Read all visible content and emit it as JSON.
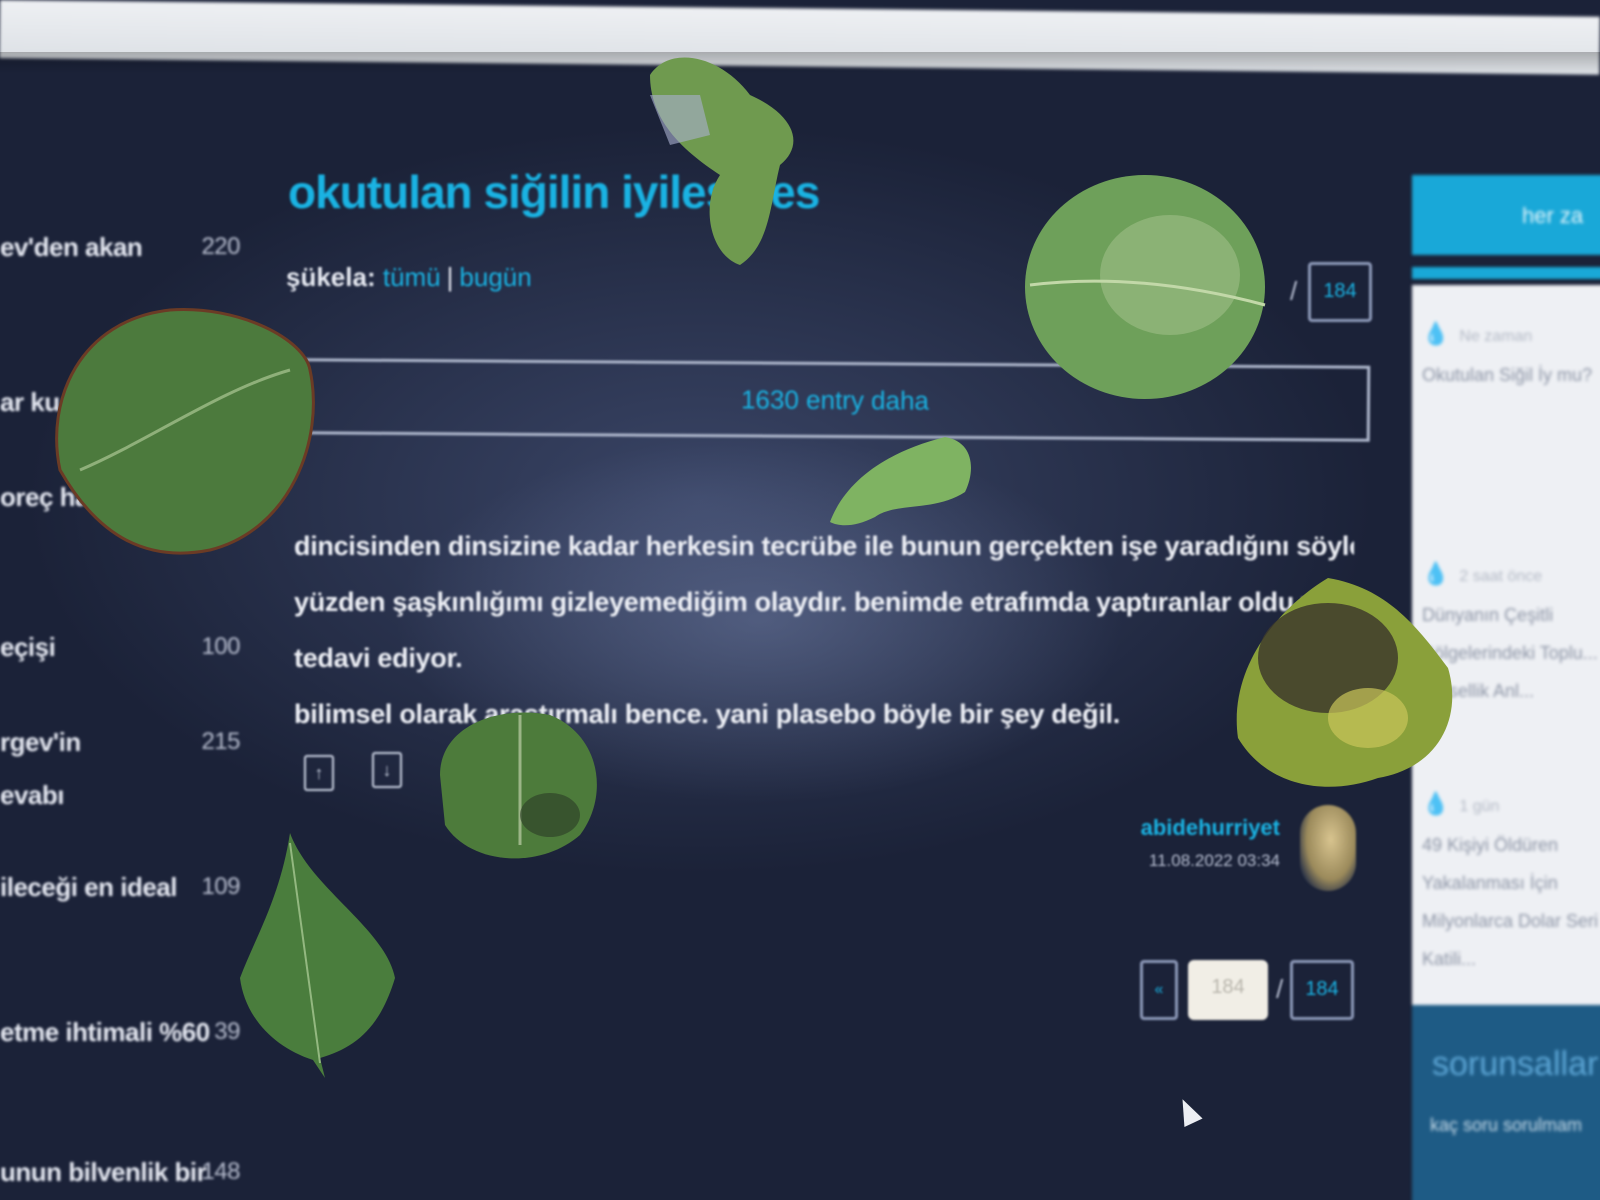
{
  "topbar": {
    "nav_items": [
      "",
      "",
      "",
      "",
      ""
    ]
  },
  "sidebar": {
    "topics": [
      {
        "label": "ev'den akan",
        "count": "220"
      },
      {
        "label": "ar ku",
        "count": ""
      },
      {
        "label": "oreç hazırlan",
        "count": ""
      },
      {
        "label": "eçişi",
        "count": "100"
      },
      {
        "label": "rgev'in",
        "count": "215"
      },
      {
        "label": "evabı",
        "count": ""
      },
      {
        "label": "ileceği en ideal",
        "count": "109"
      },
      {
        "label": "etme ihtimali %60",
        "count": "39"
      },
      {
        "label": "unun bilvenlik bir",
        "count": "148"
      }
    ]
  },
  "main": {
    "title": "okutulan siğilin iyileşmes",
    "sukela_label": "şükela:",
    "sukela_all": "tümü",
    "sukela_sep": "|",
    "sukela_today": "bugün",
    "page_total": "184",
    "more_entries": "1630 entry daha",
    "entry_lines": [
      "dincisinden dinsizine kadar herkesin tecrübe ile bunun gerçekten işe yaradığını söylediği ve bu",
      "yüzden şaşkınlığımı gizleyemediğim olaydır. benimde etrafımda yaptıranlar oldu ve sonuç !",
      "tedavi ediyor.",
      "bilimsel olarak araştırmalı bence. yani plasebo böyle bir şey değil."
    ],
    "vote_up": "↑",
    "vote_down": "↓",
    "author_name": "abidehurriyet",
    "entry_date": "11.08.2022 03:34",
    "page_current": "184",
    "slash": "/",
    "prev_label": "«"
  },
  "right_panel": {
    "tab_label": "her za",
    "cards": [
      {
        "meta": "Ne zaman",
        "text": "Okutulan Siğil İy mu?"
      },
      {
        "meta": "2 saat önce",
        "text": "Dünyanın Çeşitli Bölgelerindeki Toplu... Cinsellik Anl..."
      },
      {
        "meta": "1 gün",
        "text": "49 Kişiyi Öldüren Yakalanması İçin Milyonlarca Dolar Seri Katili..."
      }
    ],
    "bottom_title": "sorunsallar",
    "bottom_sub": "kaç soru sorulmam"
  },
  "colors": {
    "accent": "#1ab3e3",
    "background": "#2a3350",
    "text": "#eef0f6",
    "leaf_green": "#4f7f3a"
  },
  "icons": {
    "vote_up": "arrow-up-icon",
    "vote_down": "arrow-down-icon",
    "cursor": "mouse-cursor-icon"
  }
}
